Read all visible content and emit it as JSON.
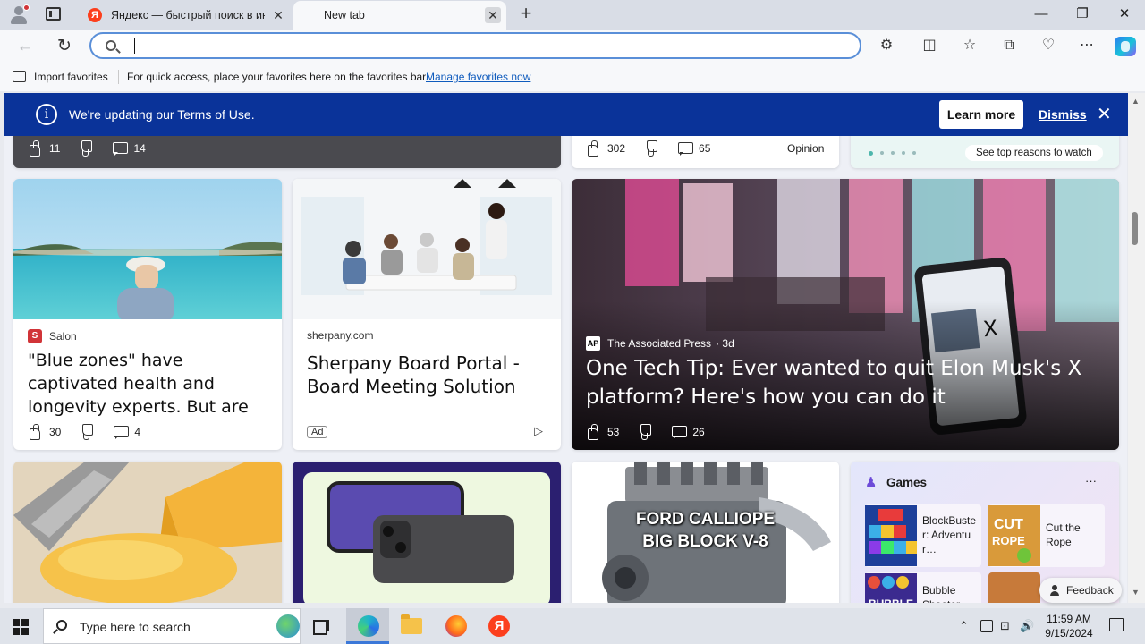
{
  "browser": {
    "tabs": [
      {
        "title": "Яндекс — быстрый поиск в инт",
        "favicon": "Я",
        "active": false
      },
      {
        "title": "New tab",
        "favicon": "page-icon",
        "active": true
      }
    ],
    "new_tab_glyph": "+",
    "window_controls": {
      "minimize": "—",
      "maximize": "❐",
      "close": "✕"
    },
    "address": {
      "value": "",
      "placeholder": ""
    },
    "back_glyph": "←",
    "reload_glyph": "↻",
    "toolbar_glyphs": {
      "extensions": "⚙",
      "split": "◫",
      "favorites": "☆",
      "collections": "⧉",
      "performance": "♡",
      "menu": "⋯"
    }
  },
  "favorites_bar": {
    "import_label": "Import favorites",
    "hint": "For quick access, place your favorites here on the favorites bar.",
    "manage_link": "Manage favorites now"
  },
  "notice": {
    "message": "We're updating our Terms of Use.",
    "learn_more": "Learn more",
    "dismiss": "Dismiss",
    "info_glyph": "i",
    "close_glyph": "✕"
  },
  "feed": {
    "top_row": {
      "left": {
        "likes": "11",
        "comments": "14"
      },
      "middle": {
        "likes": "302",
        "comments": "65",
        "tag": "Opinion"
      },
      "right": {
        "cta": "See top reasons to watch"
      }
    },
    "cards": [
      {
        "source": "Salon",
        "logo": "S",
        "headline": "\"Blue zones\" have captivated health and longevity experts. But are they real or statistic…",
        "likes": "30",
        "comments": "4"
      },
      {
        "source": "sherpany.com",
        "headline": "Sherpany Board Portal - Board Meeting Solution",
        "ad": "Ad"
      },
      {
        "source": "The Associated Press",
        "logo": "AP",
        "age": "· 3d",
        "headline": "One Tech Tip: Ever wanted to quit Elon Musk's X platform? Here's how you can do it",
        "likes": "53",
        "comments": "26"
      }
    ],
    "bottom_row": {
      "engine_caption_line1": "FORD CALLIOPE",
      "engine_caption_line2": "BIG BLOCK V-8",
      "games": {
        "title": "Games",
        "more": "···",
        "items": [
          {
            "name": "BlockBuster: Adventur…"
          },
          {
            "name": "Cut the Rope"
          },
          {
            "name": "Bubble Shooter"
          }
        ]
      }
    },
    "feedback_label": "Feedback"
  },
  "taskbar": {
    "search_placeholder": "Type here to search",
    "time": "11:59 AM",
    "date": "9/15/2024",
    "tray_glyphs": {
      "chevron": "⌃",
      "network": "⊡",
      "volume": "🔊"
    },
    "yandex_glyph": "Я"
  },
  "colors": {
    "banner": "#0a3399",
    "accent": "#0f5bbd",
    "address_border": "#5a8fd8"
  }
}
